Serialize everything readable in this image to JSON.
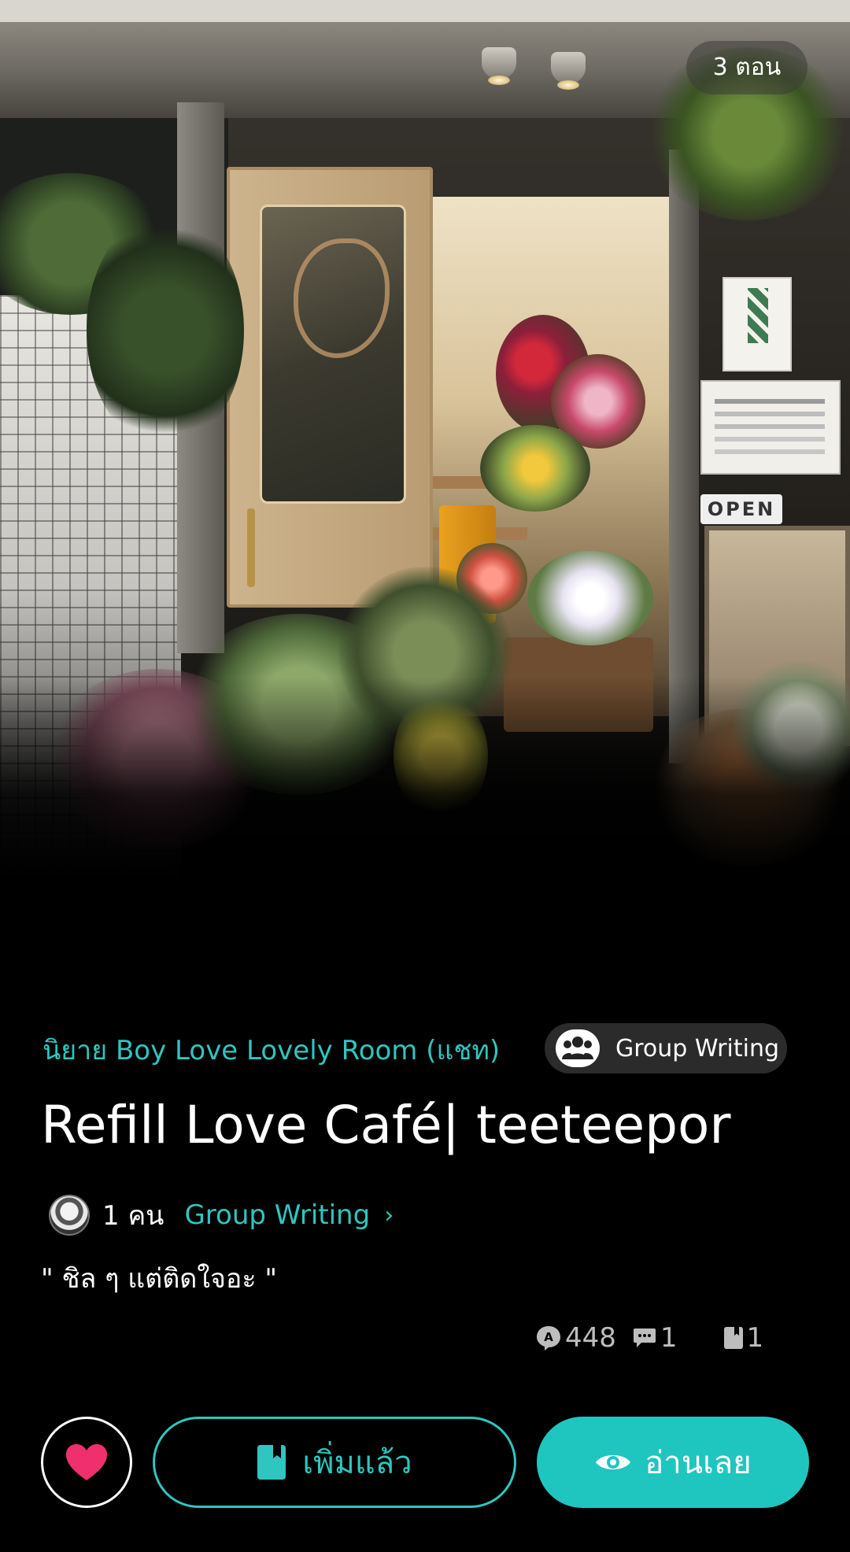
{
  "cover": {
    "episodes_label": "3 ตอน",
    "sign_text": "OPEN"
  },
  "story": {
    "category": "นิยาย Boy Love Lovely Room (แชท)",
    "badge_label": "Group Writing",
    "title": "Refill Love Café| teeteepor",
    "author_count": "1 คน",
    "author_name": "Group Writing",
    "author_chevron": "›",
    "tagline": "\" ชิล ๆ แต่ติดใจอะ \""
  },
  "stats": {
    "views": "448",
    "comments": "1",
    "bookmarks": "1"
  },
  "actions": {
    "added_label": "เพิ่มแล้ว",
    "read_label": "อ่านเลย"
  },
  "colors": {
    "accent": "#2ec6bf",
    "read_button": "#1fc6bf",
    "heart": "#f0306e",
    "background": "#000000"
  },
  "icons": {
    "group": "group-icon",
    "views": "views-icon",
    "comments": "comment-icon",
    "bookmarks": "bookmark-icon",
    "heart": "heart-icon",
    "eye": "eye-icon"
  }
}
